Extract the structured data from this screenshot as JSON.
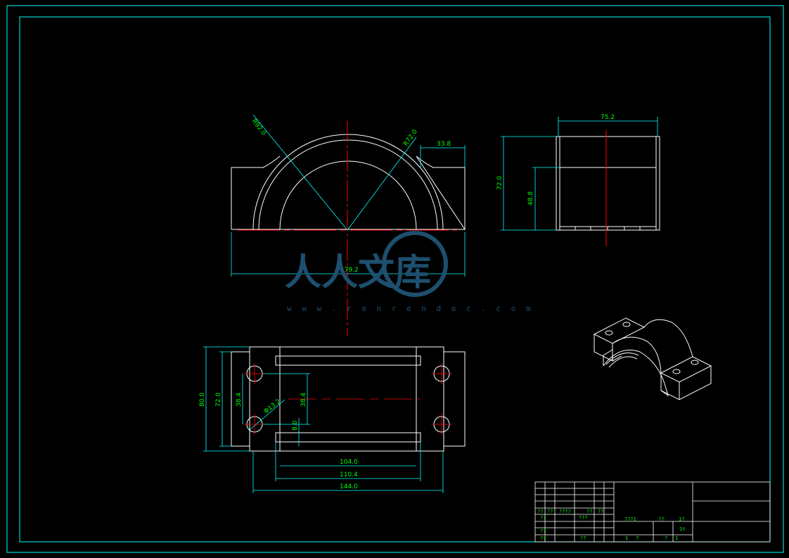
{
  "colors": {
    "background": "#000000",
    "outline": "#ffffff",
    "dimension": "#00ffff",
    "dimension_text": "#00ff00",
    "centerline": "#ff0000",
    "frame": "#00ffff",
    "watermark": "#1d4f6e"
  },
  "dimensions": {
    "d_r92": "R92.0",
    "d_r72": "R72.0",
    "d_33_8": "33.8",
    "d_179_2": "179.2",
    "d_75_2": "75.2",
    "d_72_0_side": "72.0",
    "d_48_8": "48.8",
    "d_80_0": "80.0",
    "d_72_0_top": "72.0",
    "d_38_4_left": "38.4",
    "d_38_4_mid": "38.4",
    "d_phi13_2": "Φ13.2",
    "d_8_0": "8.0",
    "d_104_0": "104.0",
    "d_110_4": "110.4",
    "d_144_0": "144.0"
  },
  "watermark": {
    "text": "人人文库",
    "url": "w w w . r e n r e n d o c . c o m"
  },
  "title_block": {
    "r1c1": "??",
    "r1c2": "??",
    "r1c3": "????",
    "r1c4": "??",
    "r1c5": "??",
    "r2c1": "??",
    "r2c3": "???",
    "r3c1": "??",
    "r4c1": "??",
    "r4c3": "??",
    "mid_1": "???1",
    "mid_2": "??",
    "mid_3": "1?",
    "mid_4": "1t",
    "mid_5": "1",
    "mid_6": "?",
    "mid_7": "?",
    "mid_8": "1"
  }
}
